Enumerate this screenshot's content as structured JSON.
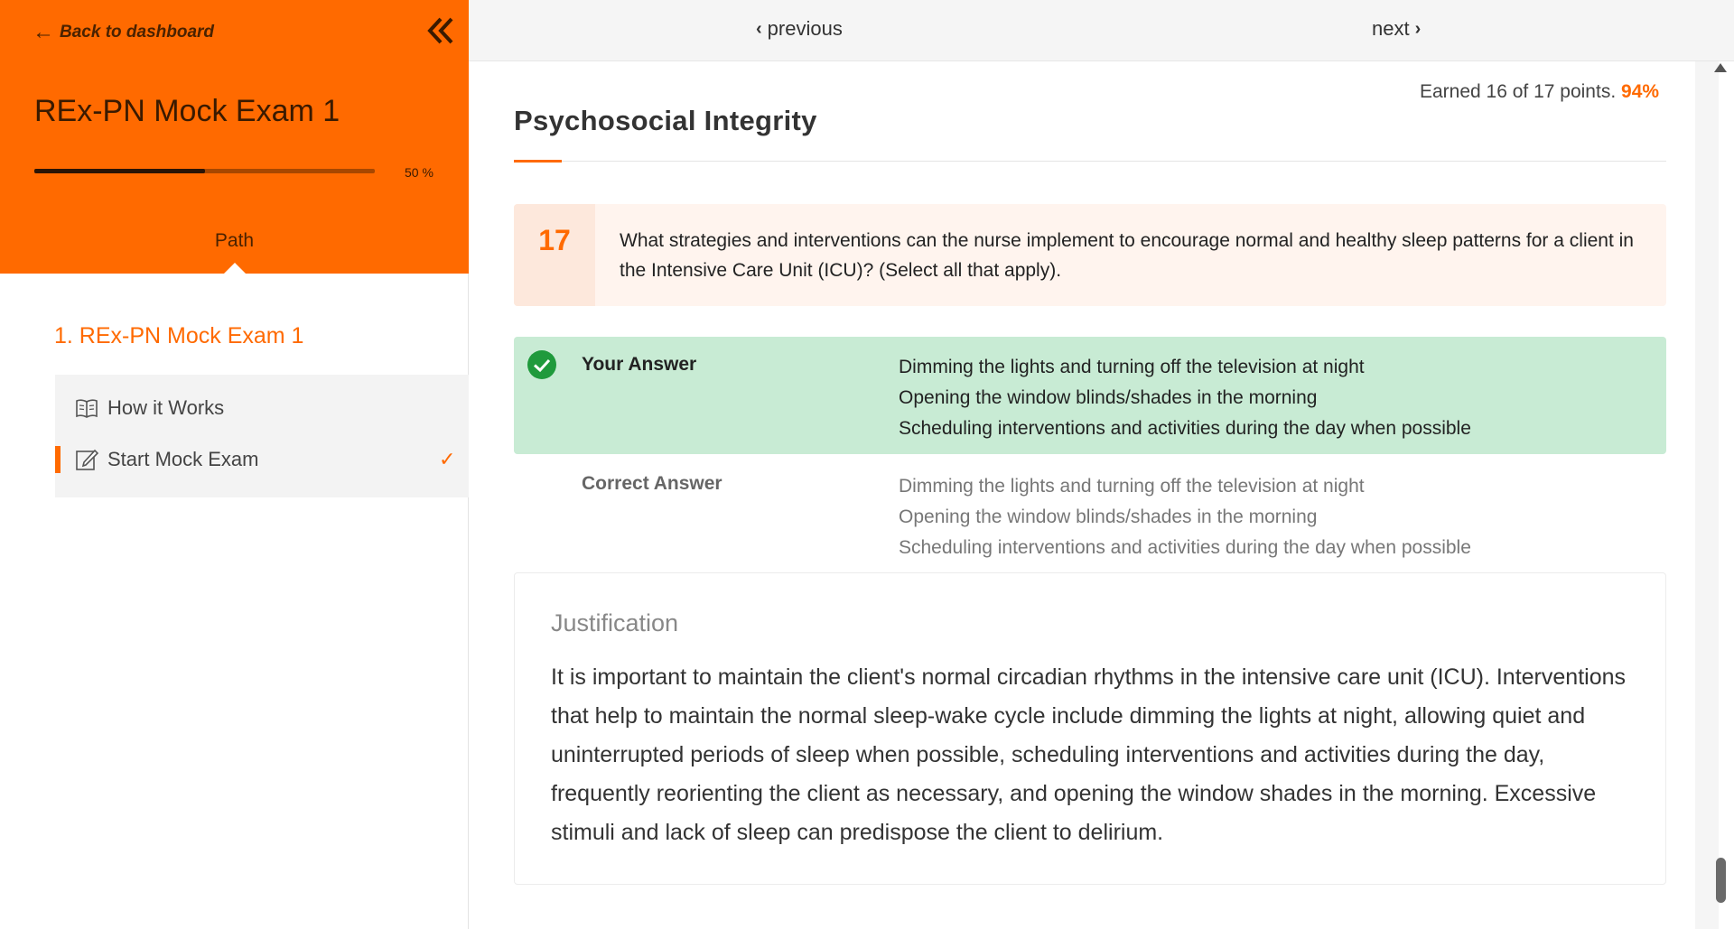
{
  "sidebar": {
    "back_label": "Back to dashboard",
    "course_title": "REx-PN Mock Exam 1",
    "progress": 0.5,
    "progress_label": "50 %",
    "path_tab": "Path",
    "section_title": "1. REx-PN Mock Exam 1",
    "lessons": [
      {
        "label": "How it Works",
        "icon": "book-icon",
        "active": false,
        "completed": false
      },
      {
        "label": "Start Mock Exam",
        "icon": "edit-icon",
        "active": true,
        "completed": true
      }
    ],
    "check_mark": "✓"
  },
  "topnav": {
    "previous_label": "previous",
    "next_label": "next"
  },
  "score": {
    "text": "Earned 16 of 17 points.",
    "percent": "94%"
  },
  "category": "Psychosocial Integrity",
  "question": {
    "number": "17",
    "text": "What strategies and interventions can the nurse implement to encourage normal and healthy sleep patterns for a client in the Intensive Care Unit (ICU)? (Select all that apply)."
  },
  "your_answer": {
    "label": "Your Answer",
    "lines": [
      "Dimming the lights and turning off the television at night",
      "Opening the window blinds/shades in the morning",
      "Scheduling interventions and activities during the day when possible"
    ]
  },
  "correct_answer": {
    "label": "Correct Answer",
    "lines": [
      "Dimming the lights and turning off the television at night",
      "Opening the window blinds/shades in the morning",
      "Scheduling interventions and activities during the day when possible"
    ]
  },
  "justification": {
    "title": "Justification",
    "text": "It is important to maintain the client's normal circadian rhythms in the intensive care unit (ICU). Interventions that help to maintain the normal sleep-wake cycle include dimming the lights at night, allowing quiet and uninterrupted periods of sleep when possible, scheduling interventions and activities during the day, frequently reorienting the client as necessary, and opening the window shades in the morning. Excessive stimuli and lack of sleep can predispose the client to delirium."
  },
  "colors": {
    "brand": "#ff6a00",
    "success_bg": "#c8ebd4",
    "success_icon": "#1f9a3c"
  }
}
